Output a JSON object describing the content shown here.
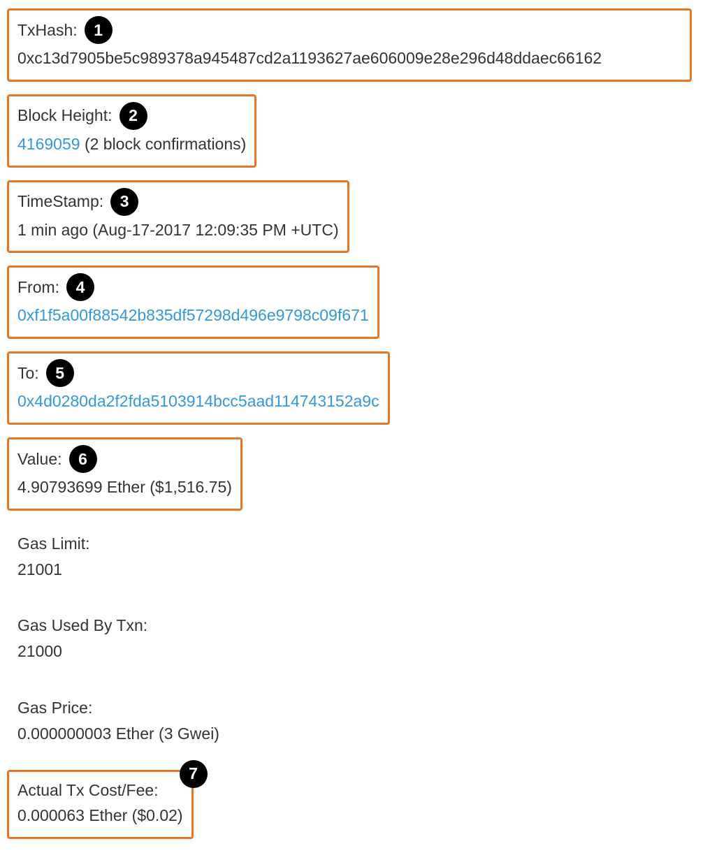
{
  "fields": {
    "txhash": {
      "label": "TxHash:",
      "value": "0xc13d7905be5c989378a945487cd2a1193627ae606009e28e296d48ddaec66162",
      "badge": "1"
    },
    "block": {
      "label": "Block Height:",
      "height": "4169059",
      "confirmations": "(2 block confirmations)",
      "badge": "2"
    },
    "time": {
      "label": "TimeStamp:",
      "value": "1 min ago (Aug-17-2017 12:09:35 PM +UTC)",
      "badge": "3"
    },
    "from": {
      "label": "From:",
      "value": "0xf1f5a00f88542b835df57298d496e9798c09f671",
      "badge": "4"
    },
    "to": {
      "label": "To:",
      "value": "0x4d0280da2f2fda5103914bcc5aad114743152a9c",
      "badge": "5"
    },
    "value": {
      "label": "Value:",
      "value": "4.90793699 Ether ($1,516.75)",
      "badge": "6"
    },
    "gaslimit": {
      "label": "Gas Limit:",
      "value": "21001"
    },
    "gasused": {
      "label": "Gas Used By Txn:",
      "value": "21000"
    },
    "gasprice": {
      "label": "Gas Price:",
      "value": "0.000000003 Ether (3 Gwei)"
    },
    "fee": {
      "label": "Actual Tx Cost/Fee:",
      "value": "0.000063 Ether ($0.02)",
      "badge": "7"
    }
  }
}
